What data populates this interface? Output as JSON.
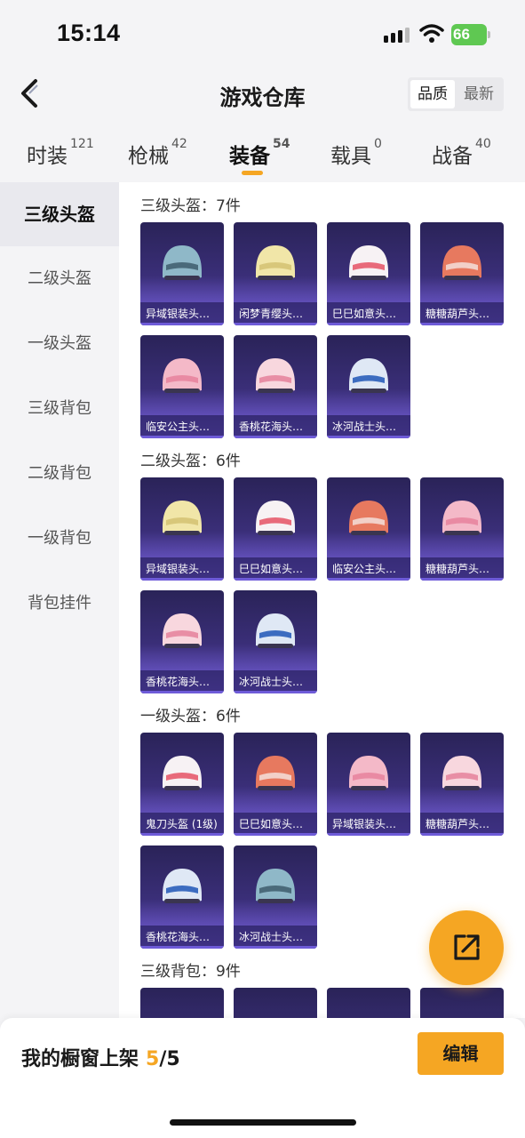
{
  "status_bar": {
    "time": "15:14",
    "battery": "66"
  },
  "header": {
    "title": "游戏仓库",
    "sort_options": [
      "品质",
      "最新"
    ]
  },
  "tabs": [
    {
      "label": "时装",
      "count": "121"
    },
    {
      "label": "枪械",
      "count": "42"
    },
    {
      "label": "装备",
      "count": "54"
    },
    {
      "label": "载具",
      "count": "0"
    },
    {
      "label": "战备",
      "count": "40"
    }
  ],
  "sidebar": {
    "active": "三级头盔",
    "items": [
      "二级头盔",
      "一级头盔",
      "三级背包",
      "二级背包",
      "一级背包",
      "背包挂件"
    ]
  },
  "sections": [
    {
      "title": "三级头盔：7件",
      "items": [
        "异域银装头…",
        "闲梦青缨头…",
        "巳巳如意头…",
        "糖糖葫芦头…",
        "临安公主头…",
        "香桃花海头…",
        "冰河战士头…"
      ]
    },
    {
      "title": "二级头盔：6件",
      "items": [
        "异域银装头…",
        "巳巳如意头…",
        "临安公主头…",
        "糖糖葫芦头…",
        "香桃花海头…",
        "冰河战士头…"
      ]
    },
    {
      "title": "一级头盔：6件",
      "items": [
        "鬼刀头盔 (1级)",
        "巳巳如意头…",
        "异域银装头…",
        "糖糖葫芦头…",
        "香桃花海头…",
        "冰河战士头…"
      ]
    },
    {
      "title": "三级背包：9件",
      "items": []
    }
  ],
  "bottom": {
    "label": "我的橱窗上架",
    "count": "5",
    "total": "/5",
    "edit_label": "编辑"
  },
  "colors": {
    "accent": "#f5a623",
    "card_bg": "#3b2f7a"
  }
}
